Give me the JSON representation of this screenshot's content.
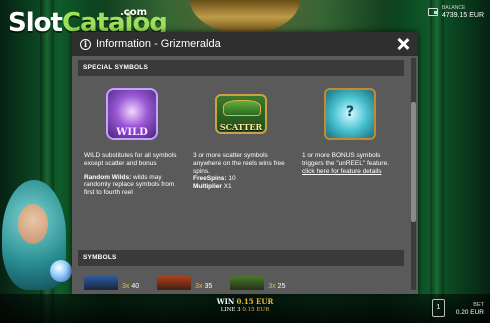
{
  "logo": {
    "part1": "Slot",
    "part2": "Catalog",
    "suffix": ".com"
  },
  "balance": {
    "label": "BALANCE",
    "value": "4739.15 EUR",
    "icon": "wallet-icon"
  },
  "dialog": {
    "title": "Information - Grizmeralda",
    "info_icon": "i",
    "close_icon": "close-icon",
    "special_section": "SPECIAL SYMBOLS",
    "symbols_section": "SYMBOLS",
    "special_symbols": [
      {
        "name": "WILD",
        "icon": "wild-symbol-icon",
        "desc1": "WILD substitutes for all symbols except scatter and bonus",
        "random_title": "Random Wilds:",
        "random_text": " wilds may randomly replace symbols from first to fourth reel"
      },
      {
        "name": "SCATTER",
        "icon": "scatter-symbol-icon",
        "desc1": "3 or more scatter symbols anywhere on the reels wins free spins.",
        "freespins_label": "FreeSpins:",
        "freespins_value": " 10",
        "multiplier_label": "Multiplier",
        "multiplier_value": " X1"
      },
      {
        "name": "?",
        "icon": "bonus-symbol-icon",
        "desc1": "1 or more BONUS symbols triggers the \"unREEL\" feature.",
        "link": "click here for feature details"
      }
    ],
    "symbols_preview": [
      {
        "mult": "3x",
        "pay": "40",
        "color": "#2c5aa0"
      },
      {
        "mult": "3x",
        "pay": "35",
        "color": "#b0401c"
      },
      {
        "mult": "3x",
        "pay": "25",
        "color": "#4a7a2a"
      }
    ]
  },
  "bottom": {
    "win_label": "WIN",
    "win_value": "0.15 EUR",
    "line_label": "LINE 3",
    "line_value": "0.15 EUR",
    "bet_label": "BET",
    "bet_value": "0.20 EUR",
    "bet_button": "1"
  },
  "colors": {
    "accent_gold": "#f2b93a",
    "dialog_bg": "#5a5a5a",
    "header_bg": "#2f2f2f",
    "logo_green": "#9fe05a"
  }
}
